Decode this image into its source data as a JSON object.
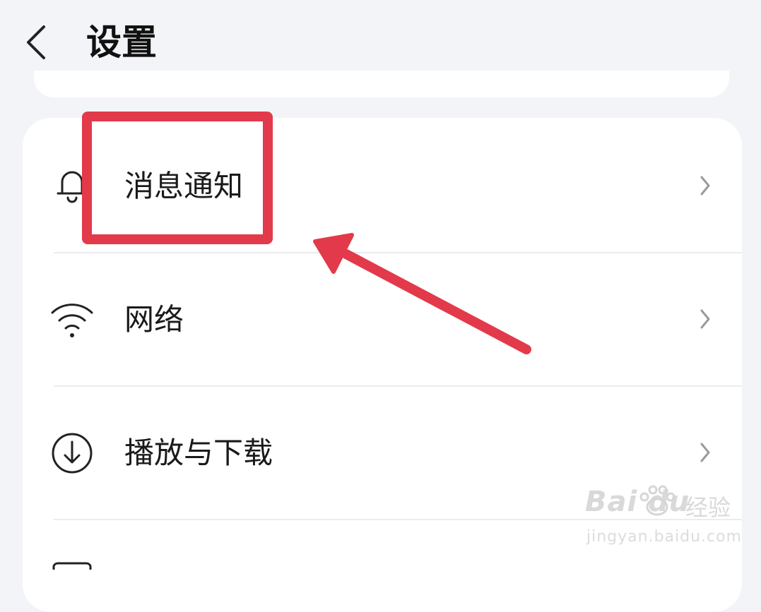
{
  "header": {
    "title": "设置",
    "back_icon": "chevron-left-icon"
  },
  "settings": {
    "items": [
      {
        "label": "消息通知",
        "icon": "bell-icon"
      },
      {
        "label": "网络",
        "icon": "wifi-icon"
      },
      {
        "label": "播放与下载",
        "icon": "download-icon"
      }
    ]
  },
  "annotation": {
    "color": "#e23a4a"
  },
  "watermark": {
    "logo": "Bai du",
    "text": "经验",
    "url": "jingyan.baidu.com"
  }
}
